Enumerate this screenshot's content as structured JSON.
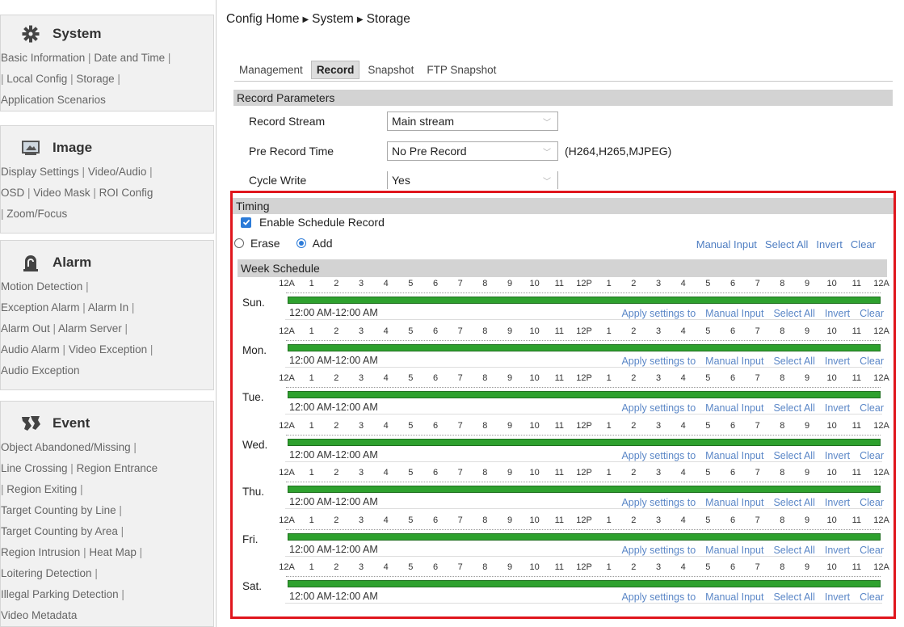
{
  "sidebar": {
    "sections": [
      {
        "id": "system",
        "title": "System",
        "icon": "gear-icon",
        "lines": [
          [
            "Basic Information",
            "Date and Time"
          ],
          [
            "Local Config",
            "Storage"
          ],
          [
            "Application Scenarios"
          ]
        ],
        "lead": [
          false,
          true,
          false
        ],
        "trail": [
          true,
          true,
          false
        ]
      },
      {
        "id": "image",
        "title": "Image",
        "icon": "image-icon",
        "lines": [
          [
            "Display Settings",
            "Video/Audio"
          ],
          [
            "OSD",
            "Video Mask",
            "ROI Config"
          ],
          [
            "Zoom/Focus"
          ]
        ],
        "lead": [
          false,
          false,
          true
        ],
        "trail": [
          true,
          false,
          false
        ]
      },
      {
        "id": "alarm",
        "title": "Alarm",
        "icon": "alarm-icon",
        "lines": [
          [
            "Motion Detection"
          ],
          [
            "Exception Alarm",
            "Alarm In"
          ],
          [
            "Alarm Out",
            "Alarm Server"
          ],
          [
            "Audio Alarm",
            "Video Exception"
          ],
          [
            "Audio Exception"
          ]
        ],
        "lead": [
          false,
          false,
          false,
          false,
          false
        ],
        "trail": [
          true,
          true,
          true,
          true,
          false
        ]
      },
      {
        "id": "event",
        "title": "Event",
        "icon": "event-icon",
        "lines": [
          [
            "Object Abandoned/Missing"
          ],
          [
            "Line Crossing",
            "Region Entrance"
          ],
          [
            "Region Exiting"
          ],
          [
            "Target Counting by Line"
          ],
          [
            "Target Counting by Area"
          ],
          [
            "Region Intrusion",
            "Heat Map"
          ],
          [
            "Loitering Detection"
          ],
          [
            "Illegal Parking Detection"
          ],
          [
            "Video Metadata"
          ]
        ],
        "lead": [
          false,
          false,
          true,
          false,
          false,
          false,
          false,
          false,
          false
        ],
        "trail": [
          true,
          false,
          true,
          true,
          true,
          true,
          true,
          true,
          false
        ]
      }
    ]
  },
  "breadcrumb": {
    "parts": [
      "Config Home",
      "System",
      "Storage"
    ]
  },
  "tabs": [
    "Management",
    "Record",
    "Snapshot",
    "FTP Snapshot"
  ],
  "active_tab": "Record",
  "record_params": {
    "title": "Record Parameters",
    "record_stream": {
      "label": "Record Stream",
      "value": "Main stream"
    },
    "pre_record": {
      "label": "Pre Record Time",
      "value": "No Pre Record",
      "note": "(H264,H265,MJPEG)"
    },
    "cycle_write": {
      "label": "Cycle Write",
      "value": "Yes"
    }
  },
  "timing": {
    "title": "Timing",
    "enable_label": "Enable Schedule Record",
    "enable_checked": true,
    "erase_label": "Erase",
    "add_label": "Add",
    "mode": "Add",
    "top_actions": [
      "Manual Input",
      "Select All",
      "Invert",
      "Clear"
    ],
    "week_title": "Week Schedule",
    "tick_labels": [
      "12A",
      "1",
      "2",
      "3",
      "4",
      "5",
      "6",
      "7",
      "8",
      "9",
      "10",
      "11",
      "12P",
      "1",
      "2",
      "3",
      "4",
      "5",
      "6",
      "7",
      "8",
      "9",
      "10",
      "11",
      "12A"
    ],
    "day_actions": [
      "Apply settings to",
      "Manual Input",
      "Select All",
      "Invert",
      "Clear"
    ],
    "days": [
      {
        "name": "Sun.",
        "range": "12:00 AM-12:00 AM"
      },
      {
        "name": "Mon.",
        "range": "12:00 AM-12:00 AM"
      },
      {
        "name": "Tue.",
        "range": "12:00 AM-12:00 AM"
      },
      {
        "name": "Wed.",
        "range": "12:00 AM-12:00 AM"
      },
      {
        "name": "Thu.",
        "range": "12:00 AM-12:00 AM"
      },
      {
        "name": "Fri.",
        "range": "12:00 AM-12:00 AM"
      },
      {
        "name": "Sat.",
        "range": "12:00 AM-12:00 AM"
      }
    ]
  },
  "colors": {
    "highlight": "#e0161d",
    "schedule_bar": "#2ea12e",
    "link": "#5b87c7",
    "checkbox": "#2c7bd8"
  }
}
